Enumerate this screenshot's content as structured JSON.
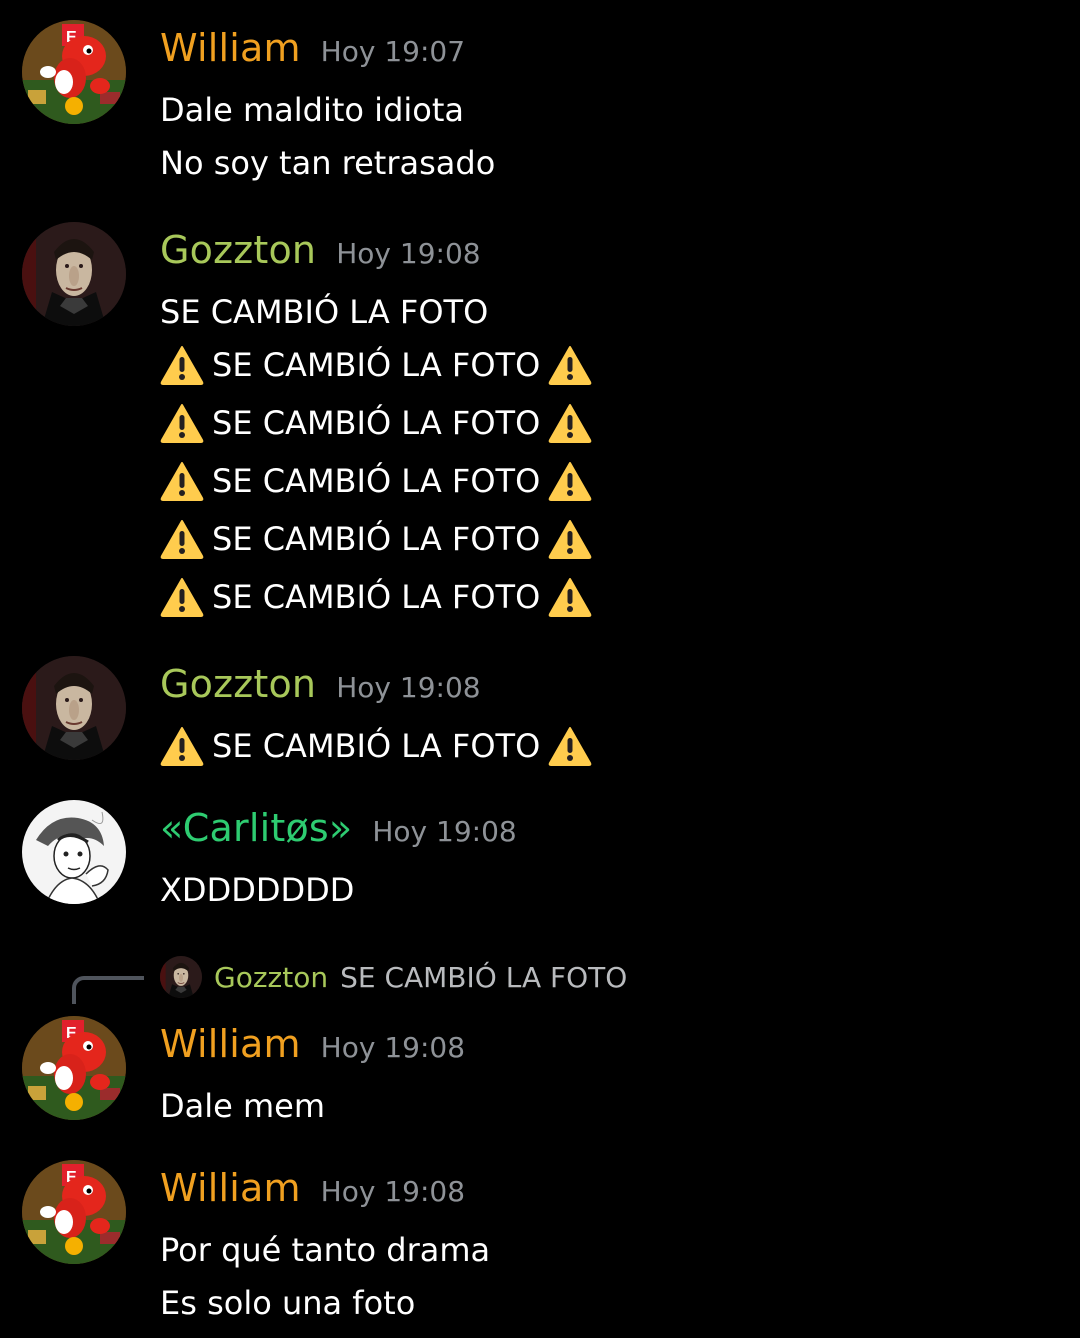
{
  "colors": {
    "background": "#000000",
    "william": "#f0a020",
    "gozzton": "#a8c85a",
    "carlitos": "#2ecc71",
    "timestamp": "#8e9297",
    "reply_text": "#b9bbbe"
  },
  "messages": [
    {
      "author": "William",
      "time": "Hoy 19:07",
      "avatar": "yoshi-avatar",
      "lines": [
        "Dale maldito idiota",
        "No soy tan retrasado"
      ]
    },
    {
      "author": "Gozzton",
      "time": "Hoy 19:08",
      "avatar": "dracula-avatar",
      "lines": [
        "SE CAMBIÓ LA FOTO",
        "SE CAMBIÓ LA FOTO",
        "SE CAMBIÓ LA FOTO",
        "SE CAMBIÓ LA FOTO",
        "SE CAMBIÓ LA FOTO",
        "SE CAMBIÓ LA FOTO"
      ]
    },
    {
      "author": "Gozzton",
      "time": "Hoy 19:08",
      "avatar": "dracula-avatar",
      "lines": [
        "SE CAMBIÓ LA FOTO"
      ]
    },
    {
      "author": "«Carlitøs»",
      "time": "Hoy 19:08",
      "avatar": "anime-sketch-avatar",
      "lines": [
        "XDDDDDDD"
      ]
    },
    {
      "author": "William",
      "time": "Hoy 19:08",
      "avatar": "yoshi-avatar",
      "reply": {
        "author": "Gozzton",
        "text": "SE CAMBIÓ LA FOTO"
      },
      "lines": [
        "Dale mem"
      ]
    },
    {
      "author": "William",
      "time": "Hoy 19:08",
      "avatar": "yoshi-avatar",
      "lines": [
        "Por qué tanto drama",
        "Es solo una foto"
      ]
    }
  ],
  "icons": {
    "warning": "warning-icon"
  }
}
